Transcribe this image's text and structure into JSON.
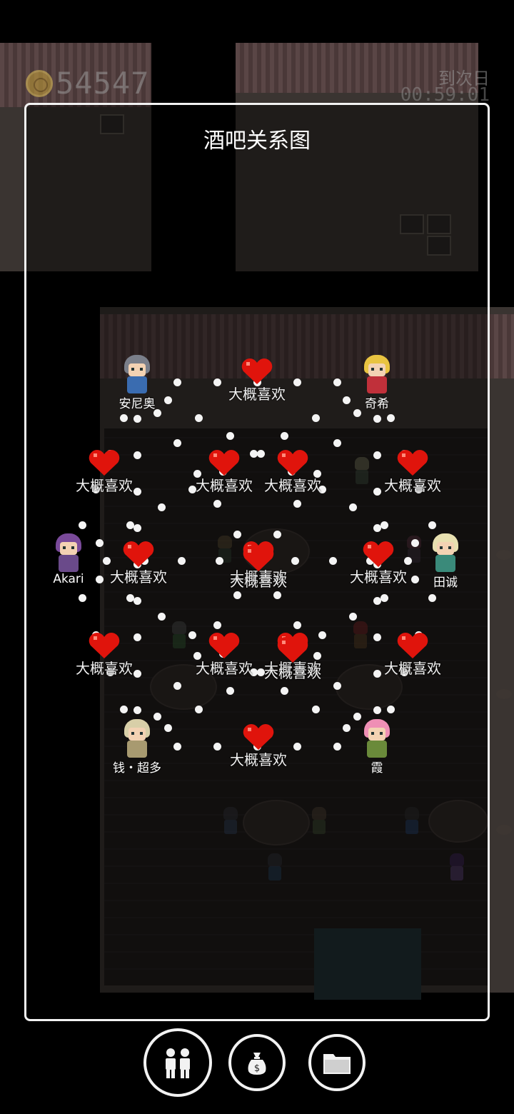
{
  "hud": {
    "coins": "54547",
    "next_day_label": "到次日",
    "timer": "00:59:01"
  },
  "panel": {
    "title": "酒吧关系图"
  },
  "characters": [
    {
      "name": "安尼奥",
      "hair": "#7a7f8a",
      "torso": "#3a6cb0"
    },
    {
      "name": "奇希",
      "hair": "#e9c441",
      "torso": "#c0303a"
    },
    {
      "name": "Akari",
      "hair": "#7a4a9a",
      "torso": "#6a4a8a"
    },
    {
      "name": "田诚",
      "hair": "#e8e0b0",
      "torso": "#3a8a7a"
    },
    {
      "name": "钱・超多",
      "hair": "#d8cfa8",
      "torso": "#a89a70"
    },
    {
      "name": "霞",
      "hair": "#ef8fb5",
      "torso": "#6a8a3a"
    }
  ],
  "relationships": [
    {
      "label": "大概喜欢"
    },
    {
      "label": "大概喜欢"
    },
    {
      "label": "大概喜欢"
    },
    {
      "label": "大概喜欢"
    },
    {
      "label": "大概喜欢"
    },
    {
      "label": "大概喜欢"
    },
    {
      "label": "大概喜欢"
    },
    {
      "label": "大概喜欢"
    },
    {
      "label": "大概喜欢"
    },
    {
      "label": "大概喜欢"
    },
    {
      "label": "大概喜欢"
    },
    {
      "label": "大概喜欢"
    },
    {
      "label": "大概喜欢"
    },
    {
      "label": "大概喜欢"
    },
    {
      "label": "大概喜欢"
    }
  ],
  "colors": {
    "heart": "#e0140c",
    "border": "#f2f2f2"
  },
  "toolbar": {
    "icons": [
      "people-icon",
      "money-bag-icon",
      "folder-icon"
    ]
  }
}
